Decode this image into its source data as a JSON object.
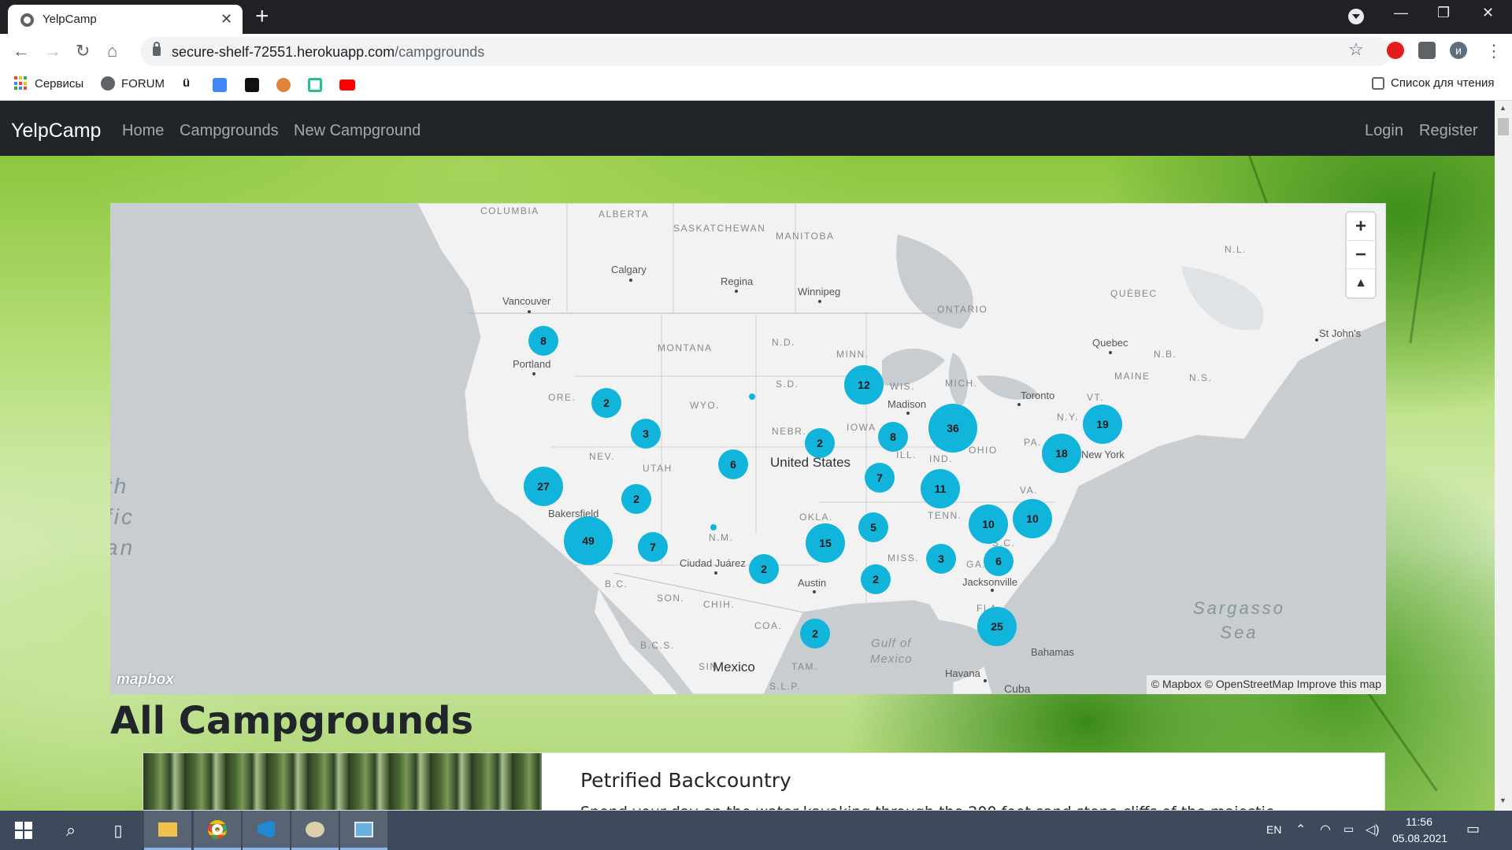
{
  "browser": {
    "tab_title": "YelpCamp",
    "tab_close": "✕",
    "new_tab": "+",
    "url_host": "secure-shelf-72551.herokuapp.com",
    "url_path": "/campgrounds",
    "bookmarks": [
      {
        "label": "Сервисы",
        "icon": "apps-grid-icon"
      },
      {
        "label": "FORUM",
        "icon": "globe-icon"
      },
      {
        "label": "",
        "icon": "bookmark-icon-1"
      },
      {
        "label": "",
        "icon": "translate-icon"
      },
      {
        "label": "",
        "icon": "bookmark-icon-3"
      },
      {
        "label": "",
        "icon": "bookmark-icon-4"
      },
      {
        "label": "",
        "icon": "bookmark-icon-5"
      },
      {
        "label": "",
        "icon": "youtube-icon"
      }
    ],
    "reading_list": "Список для чтения",
    "profile_initial": "и"
  },
  "navbar": {
    "brand": "YelpCamp",
    "links": [
      "Home",
      "Campgrounds",
      "New Campground"
    ],
    "right_links": [
      "Login",
      "Register"
    ]
  },
  "map": {
    "regions": [
      "COLUMBIA",
      "ALBERTA",
      "SASKATCHEWAN",
      "MANITOBA",
      "ONTARIO",
      "QUÉBEC",
      "N.L.",
      "MONTANA",
      "N.D.",
      "MINN.",
      "S.D.",
      "WYO.",
      "ORE.",
      "NEV.",
      "UTAH",
      "NEBR.",
      "IOWA",
      "WIS.",
      "MICH.",
      "ILL.",
      "IND.",
      "OHIO",
      "PA.",
      "N.Y.",
      "VT.",
      "MAINE",
      "N.B.",
      "N.S.",
      "VA.",
      "OKLA.",
      "N.M.",
      "TENN.",
      "MISS.",
      "GA.",
      "S.C.",
      "FLA.",
      "B.C.",
      "SON.",
      "CHIH.",
      "COA.",
      "B.C.S.",
      "SIN.",
      "TAM.",
      "S.L.P."
    ],
    "places": [
      "Calgary",
      "Regina",
      "Winnipeg",
      "Vancouver",
      "Portland",
      "Madison",
      "Toronto",
      "Quebec",
      "St John's",
      "New York",
      "Bakersfield",
      "Ciudad Juárez",
      "Austin",
      "Jacksonville",
      "Bahamas",
      "Havana",
      "Cuba"
    ],
    "countries": [
      "United States",
      "Mexico"
    ],
    "oceans": [
      "Sargasso\nSea",
      "Gulf of\nMexico",
      "th\nfic\nan"
    ],
    "clusters": [
      {
        "count": "8"
      },
      {
        "count": "2"
      },
      {
        "count": "3"
      },
      {
        "count": "27"
      },
      {
        "count": "49"
      },
      {
        "count": "2"
      },
      {
        "count": "7"
      },
      {
        "count": "6"
      },
      {
        "count": "2"
      },
      {
        "count": "2"
      },
      {
        "count": "12"
      },
      {
        "count": "8"
      },
      {
        "count": "36"
      },
      {
        "count": "7"
      },
      {
        "count": "11"
      },
      {
        "count": "5"
      },
      {
        "count": "15"
      },
      {
        "count": "2"
      },
      {
        "count": "2"
      },
      {
        "count": "3"
      },
      {
        "count": "10"
      },
      {
        "count": "10"
      },
      {
        "count": "6"
      },
      {
        "count": "25"
      },
      {
        "count": "19"
      },
      {
        "count": "18"
      }
    ],
    "zoom_in": "+",
    "zoom_out": "−",
    "compass": "▲",
    "logo": "mapbox",
    "attribution": "© Mapbox © OpenStreetMap Improve this map"
  },
  "campgrounds": {
    "heading": "All Campgrounds",
    "items": [
      {
        "title": "Petrified Backcountry",
        "description": "Spend your day on the water kayaking through the 200 foot sand stone cliffs of the majestic"
      }
    ]
  },
  "taskbar": {
    "language": "EN",
    "time": "11:56",
    "date": "05.08.2021"
  },
  "colors": {
    "cluster": "#11b4da",
    "navbar": "#212529",
    "map_land": "#f2f2f2",
    "map_water": "#c7cdd1"
  }
}
